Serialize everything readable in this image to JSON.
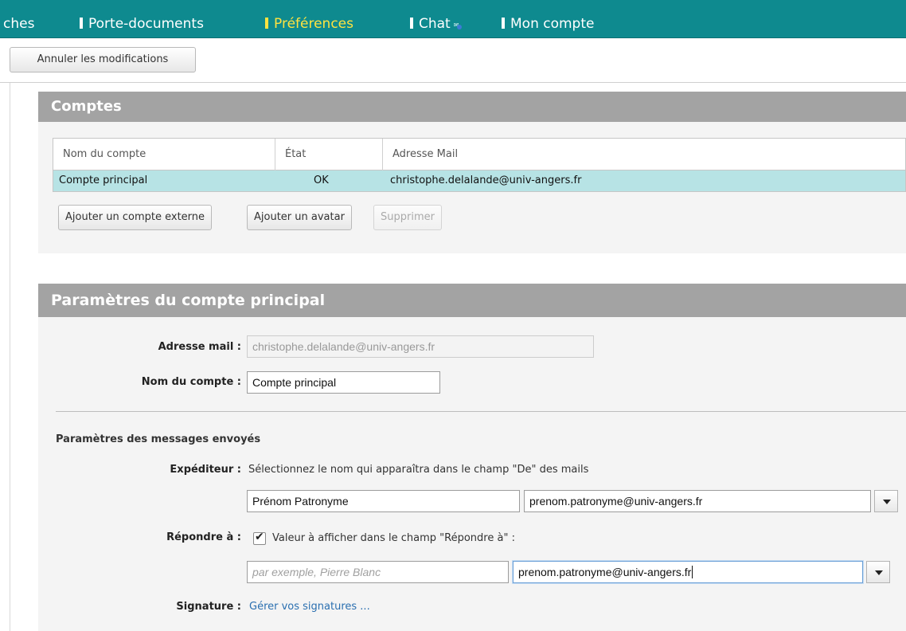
{
  "nav": {
    "items": [
      {
        "label": "ches",
        "active": false
      },
      {
        "label": "Porte-documents",
        "active": false
      },
      {
        "label": "Préférences",
        "active": true
      },
      {
        "label": "Chat",
        "active": false
      },
      {
        "label": "Mon compte",
        "active": false
      }
    ],
    "chat_badge": "✉",
    "colors": {
      "background": "#0e8a8f",
      "active": "#ffe340",
      "text": "#ffffff"
    }
  },
  "toolbar": {
    "cancel_label": "Annuler les modifications"
  },
  "accounts": {
    "title": "Comptes",
    "columns": [
      "Nom du compte",
      "État",
      "Adresse Mail"
    ],
    "rows": [
      {
        "name": "Compte principal",
        "state": "OK",
        "email": "christophe.delalande@univ-angers.fr",
        "selected": true
      }
    ],
    "buttons": {
      "add_external": "Ajouter un compte externe",
      "add_avatar": "Ajouter un avatar",
      "delete": "Supprimer"
    }
  },
  "settings": {
    "title": "Paramètres du compte principal",
    "email_label": "Adresse mail :",
    "email_value": "christophe.delalande@univ-angers.fr",
    "account_name_label": "Nom du compte :",
    "account_name_value": "Compte principal",
    "sent_section_title": "Paramètres des messages envoyés",
    "sender_label": "Expéditeur :",
    "sender_hint": "Sélectionnez le nom qui apparaîtra dans le champ \"De\" des mails",
    "sender_name_value": "Prénom Patronyme",
    "sender_email_value": "prenom.patronyme@univ-angers.fr",
    "reply_label": "Répondre à :",
    "reply_checked": true,
    "reply_hint": "Valeur à afficher dans le champ \"Répondre à\" :",
    "reply_name_placeholder": "par exemple, Pierre Blanc",
    "reply_email_value": "prenom.patronyme@univ-angers.fr",
    "signature_label": "Signature :",
    "signature_link": "Gérer vos signatures ..."
  }
}
